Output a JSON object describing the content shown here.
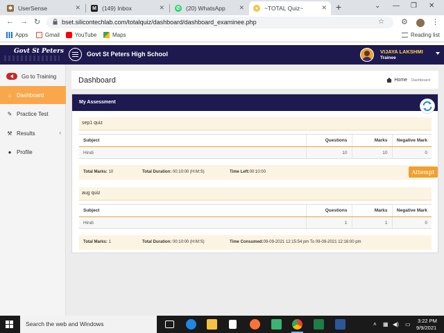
{
  "browser": {
    "tabs": [
      {
        "label": "UserSense"
      },
      {
        "label": "(149) Inbox"
      },
      {
        "label": "(20) WhatsApp"
      },
      {
        "label": "~TOTAL Quiz~"
      }
    ],
    "url": "bset.silicontechlab.com/totalquiz/dashboard/dashboard_examinee.php",
    "bookmarks": [
      {
        "label": "Apps"
      },
      {
        "label": "Gmail"
      },
      {
        "label": "YouTube"
      },
      {
        "label": "Maps"
      }
    ],
    "reading_list": "Reading list"
  },
  "header": {
    "brand": "Govt St Peters",
    "school_name": "Govt St Peters High School",
    "user_name": "VIJAYA LAKSHMI",
    "user_role": "Trainee"
  },
  "sidebar": {
    "go_training": "Go to Training",
    "items": [
      {
        "label": "Dashboard",
        "icon": "home-icon"
      },
      {
        "label": "Practice Test",
        "icon": "edit-icon"
      },
      {
        "label": "Results",
        "icon": "wrench-icon"
      },
      {
        "label": "Profile",
        "icon": "user-icon"
      }
    ]
  },
  "page": {
    "title": "Dashboard",
    "breadcrumb_home": "Home",
    "breadcrumb_current": "Dashboard"
  },
  "assessment": {
    "panel_title": "My Assessment",
    "columns": [
      "Subject",
      "Questions",
      "Marks",
      "Negative Mark"
    ],
    "quizzes": [
      {
        "name": "sep1 quiz",
        "rows": [
          {
            "subject": "Hindi",
            "questions": "10",
            "marks": "10",
            "negative": "0"
          }
        ],
        "total_marks_label": "Total Marks:",
        "total_marks": "10",
        "duration_label": "Total Duration:",
        "duration": "00:10:00 (H:M:S)",
        "time_label": "Time Left:",
        "time_value": "00:10:00",
        "action": "Attempt"
      },
      {
        "name": "aug quiz",
        "rows": [
          {
            "subject": "Hindi",
            "questions": "1",
            "marks": "1",
            "negative": "0"
          }
        ],
        "total_marks_label": "Total Marks:",
        "total_marks": "1",
        "duration_label": "Total Duration:",
        "duration": "00:10:00 (H:M:S)",
        "time_label": "Time Consumed:",
        "time_value": "09-09-2021 12:15:54 pm To 09-09-2021 12:16:00 pm"
      }
    ]
  },
  "taskbar": {
    "search_placeholder": "Search the web and Windows",
    "time": "3:22 PM",
    "date": "9/9/2021"
  },
  "colors": {
    "header_navy": "#1e1a4f",
    "accent_orange": "#f0a030",
    "active_menu": "#f9a74a",
    "summary_bg": "#fcf4e2"
  }
}
